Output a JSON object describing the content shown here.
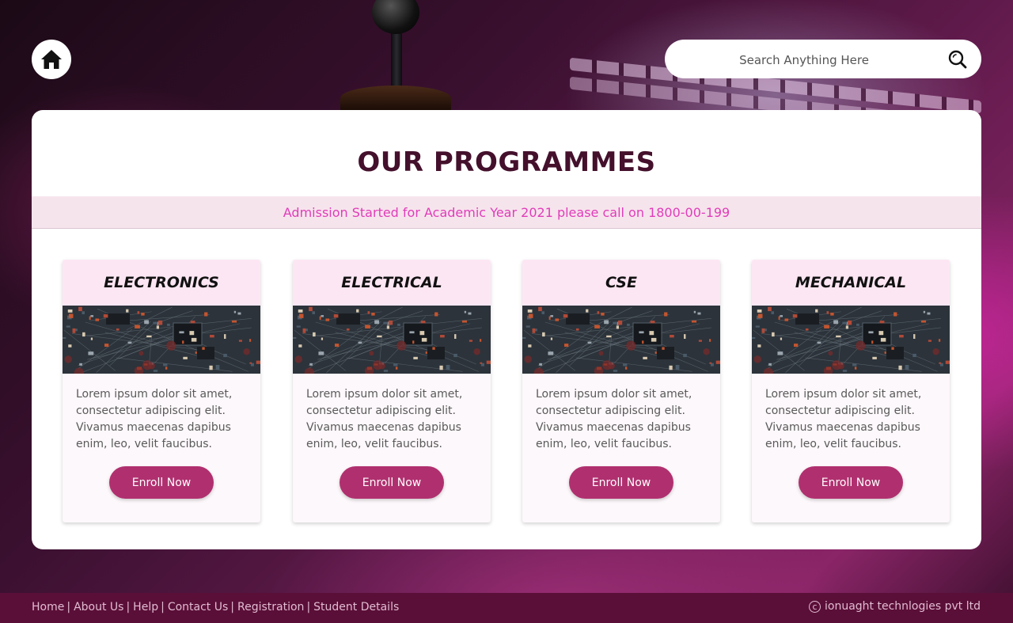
{
  "header": {
    "home_icon": "home-icon",
    "search": {
      "placeholder": "Search Anything Here",
      "value": "",
      "icon": "search-icon"
    }
  },
  "panel": {
    "title": "OUR PROGRAMMES",
    "notice": "Admission Started for Academic Year 2021 please call on 1800-00-199"
  },
  "programmes": [
    {
      "title": "ELECTRONICS",
      "description": "Lorem ipsum dolor sit amet, consectetur adipiscing elit. Vivamus maecenas dapibus enim, leo, velit faucibus.",
      "button": "Enroll Now"
    },
    {
      "title": "ELECTRICAL",
      "description": "Lorem ipsum dolor sit amet, consectetur adipiscing elit. Vivamus maecenas dapibus enim, leo, velit faucibus.",
      "button": "Enroll Now"
    },
    {
      "title": "CSE",
      "description": "Lorem ipsum dolor sit amet, consectetur adipiscing elit. Vivamus maecenas dapibus enim, leo, velit faucibus.",
      "button": "Enroll Now"
    },
    {
      "title": "MECHANICAL",
      "description": "Lorem ipsum dolor sit amet, consectetur adipiscing elit. Vivamus maecenas dapibus enim, leo, velit faucibus.",
      "button": "Enroll Now"
    }
  ],
  "footer": {
    "links": [
      "Home",
      "About Us",
      "Help",
      "Contact Us",
      "Registration",
      "Student Details"
    ],
    "separator": "|",
    "copyright_icon": "copyright-icon",
    "copyright": "ionuaght technlogies pvt ltd"
  },
  "colors": {
    "title": "#44102c",
    "notice_text": "#e03cba",
    "notice_bg": "#f6e4ec",
    "card_head_bg": "#fde6f3",
    "button": "#b0306f",
    "footer_bg": "#5a0f38"
  }
}
